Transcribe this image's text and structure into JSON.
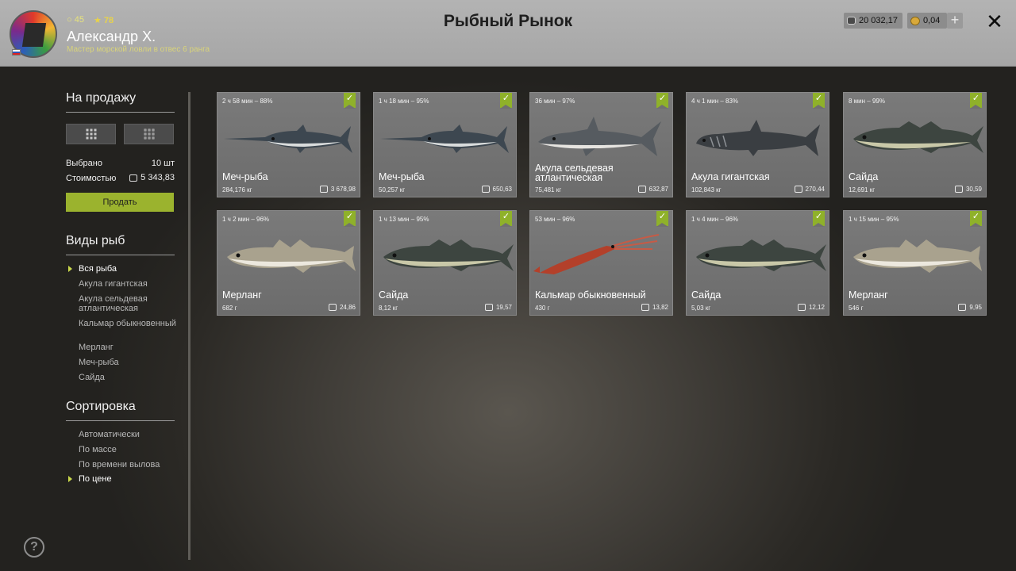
{
  "player": {
    "level": "45",
    "stars": "78",
    "name": "Александр Х.",
    "rank": "Мастер морской ловли в отвес 6 ранга"
  },
  "header": {
    "title": "Рыбный Рынок",
    "silver": "20 032,17",
    "gold": "0,04",
    "add": "+",
    "close": "✕"
  },
  "sidebar": {
    "sale_title": "На продажу",
    "selected_label": "Выбрано",
    "selected_value": "10 шт",
    "cost_label": "Стоимостью",
    "cost_value": "5 343,83",
    "sell_button": "Продать",
    "species_title": "Виды рыб",
    "species": [
      {
        "label": "Вся рыба",
        "active": true
      },
      {
        "label": "Акула гигантская",
        "active": false
      },
      {
        "label": "Акула сельдевая атлантическая",
        "active": false
      },
      {
        "label": "Кальмар обыкновенный",
        "active": false
      },
      {
        "label": "Мерланг",
        "active": false
      },
      {
        "label": "Меч-рыба",
        "active": false
      },
      {
        "label": "Сайда",
        "active": false
      }
    ],
    "sort_title": "Сортировка",
    "sort": [
      {
        "label": "Автоматически",
        "active": false
      },
      {
        "label": "По массе",
        "active": false
      },
      {
        "label": "По времени вылова",
        "active": false
      },
      {
        "label": "По цене",
        "active": true
      }
    ],
    "help": "?"
  },
  "colors": {
    "accent": "#9bb32e",
    "check": "#8fb12a",
    "header_bg": "#adadad"
  },
  "cards": [
    {
      "time": "2 ч 58 мин – 88%",
      "name": "Меч-рыба",
      "weight": "284,176 кг",
      "price": "3 678,98",
      "fish": "swordfish"
    },
    {
      "time": "1 ч 18 мин – 95%",
      "name": "Меч-рыба",
      "weight": "50,257 кг",
      "price": "650,63",
      "fish": "swordfish"
    },
    {
      "time": "36 мин – 97%",
      "name": "Акула сельдевая атлантическая",
      "weight": "75,481 кг",
      "price": "632,87",
      "fish": "porbeagle"
    },
    {
      "time": "4 ч 1 мин – 83%",
      "name": "Акула гигантская",
      "weight": "102,843 кг",
      "price": "270,44",
      "fish": "basking"
    },
    {
      "time": "8 мин – 99%",
      "name": "Сайда",
      "weight": "12,691 кг",
      "price": "30,59",
      "fish": "saithe"
    },
    {
      "time": "1 ч 2 мин – 96%",
      "name": "Мерланг",
      "weight": "682 г",
      "price": "24,86",
      "fish": "whiting"
    },
    {
      "time": "1 ч 13 мин – 95%",
      "name": "Сайда",
      "weight": "8,12 кг",
      "price": "19,57",
      "fish": "saithe"
    },
    {
      "time": "53 мин – 96%",
      "name": "Кальмар обыкновенный",
      "weight": "430 г",
      "price": "13,82",
      "fish": "squid"
    },
    {
      "time": "1 ч 4 мин – 96%",
      "name": "Сайда",
      "weight": "5,03 кг",
      "price": "12,12",
      "fish": "saithe"
    },
    {
      "time": "1 ч 15 мин – 95%",
      "name": "Мерланг",
      "weight": "546 г",
      "price": "9,95",
      "fish": "whiting"
    }
  ]
}
